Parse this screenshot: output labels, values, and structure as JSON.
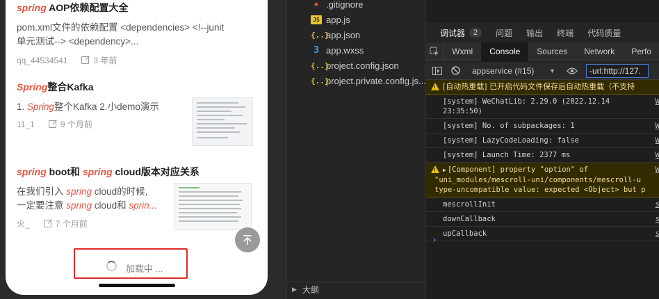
{
  "articles": [
    {
      "title_hl": "spring",
      "title_rest": " AOP依赖配置大全",
      "desc_line1": "pom.xml文件的依赖配置 <dependencies> <!--junit",
      "desc_line2": "单元测试--> <dependency>...",
      "author": "qq_44534541",
      "time": "3 年前"
    },
    {
      "title_hl": "Spring",
      "title_rest": "整合Kafka",
      "desc_pre": "1. ",
      "desc_hl": "Spring",
      "desc_rest": "整个Kafka 2.小demo演示",
      "author": "11_1",
      "time": "9 个月前"
    },
    {
      "title_hl1": "spring",
      "title_mid": " boot和 ",
      "title_hl2": "spring",
      "title_rest": " cloud版本对应关系",
      "d1_pre": "在我们引入 ",
      "d1_hl": "spring",
      "d1_rest": " cloud的时候,",
      "d2_pre": "一定要注意 ",
      "d2_hl": "spring",
      "d2_mid": " cloud和 ",
      "d2_hl2": "sprin...",
      "author": "火_",
      "time": "7 个月前"
    }
  ],
  "loading_text": "加载中 ...",
  "files": [
    {
      "name": ".gitignore",
      "icon": "git-icon"
    },
    {
      "name": "app.js",
      "icon": "js-icon"
    },
    {
      "name": "app.json",
      "icon": "json-icon"
    },
    {
      "name": "app.wxss",
      "icon": "css-icon"
    },
    {
      "name": "project.config.json",
      "icon": "json-icon"
    },
    {
      "name": "project.private.config.js...",
      "icon": "json-icon"
    }
  ],
  "outline_label": "大纲",
  "debugger_tabs": {
    "t1": "调试器",
    "t1_badge": "2",
    "t2": "问题",
    "t3": "输出",
    "t4": "终端",
    "t5": "代码质量"
  },
  "devtools_tabs": [
    "Wxml",
    "Console",
    "Sources",
    "Network",
    "Perfo"
  ],
  "toolbar": {
    "context": "appservice (#15)",
    "filter": "-url:http://127."
  },
  "console_rows": {
    "r1": "[自动热重载] 已开启代码文件保存后自动热重载（不支持",
    "r2a": "[system] WeChatLib: 2.29.0 (2022.12.14",
    "r2b": "23:35:50)",
    "r2_src": "W",
    "r3": "[system] No. of subpackages: 1",
    "r3_src": "W",
    "r4": "[system] LazyCodeLoading: false",
    "r4_src": "W",
    "r5": "[system] Launch Time: 2377 ms",
    "r5_src": "W",
    "r6a": "[Component] property \"option\" of",
    "r6b": "\"uni_modules/mescroll-uni/components/mescroll-u",
    "r6c": "type-uncompatible value: expected <Object> but p",
    "r6_src": "W",
    "r7": "mescrollInit",
    "r7_src": "s",
    "r8": "downCallback",
    "r8_src": "s",
    "r9": "upCallback",
    "r9_src": "s",
    "prompt": "›"
  },
  "colors": {
    "highlight": "#e8543e",
    "loading_border": "#e02b2b",
    "warn_bg": "#332b00"
  }
}
